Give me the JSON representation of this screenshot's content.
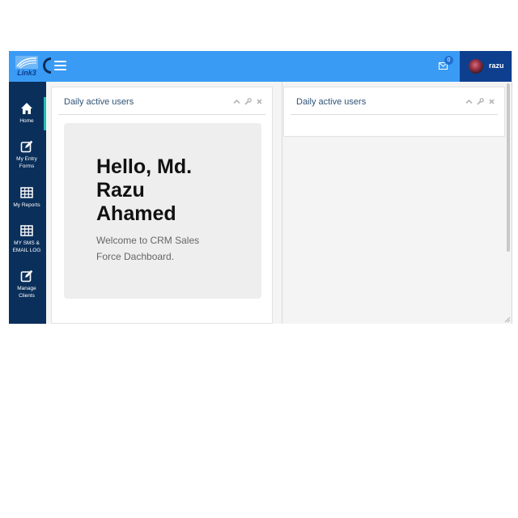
{
  "header": {
    "logo_text": "Link3",
    "mail_badge": "0",
    "username": "razu",
    "accent_color": "#3a9bf5",
    "user_area_color": "#0d3f8e"
  },
  "sidebar": {
    "background": "#0a2f5a",
    "items": [
      {
        "label": "Home",
        "icon": "home-icon"
      },
      {
        "label_line1": "My Entry",
        "label_line2": "Forms",
        "icon": "edit-icon"
      },
      {
        "label": "My Reports",
        "icon": "table-icon"
      },
      {
        "label_line1": "MY SMS &",
        "label_line2": "EMAIL LOG",
        "icon": "table-icon"
      },
      {
        "label_line1": "Manage",
        "label_line2": "Clients",
        "icon": "edit-icon"
      }
    ]
  },
  "panels": [
    {
      "title": "Daily active users",
      "greeting_line1": "Hello, Md.",
      "greeting_line2": "Razu",
      "greeting_line3": "Ahamed",
      "welcome_line1": "Welcome to CRM Sales",
      "welcome_line2": "Force Dachboard."
    },
    {
      "title": "Daily active users"
    }
  ]
}
